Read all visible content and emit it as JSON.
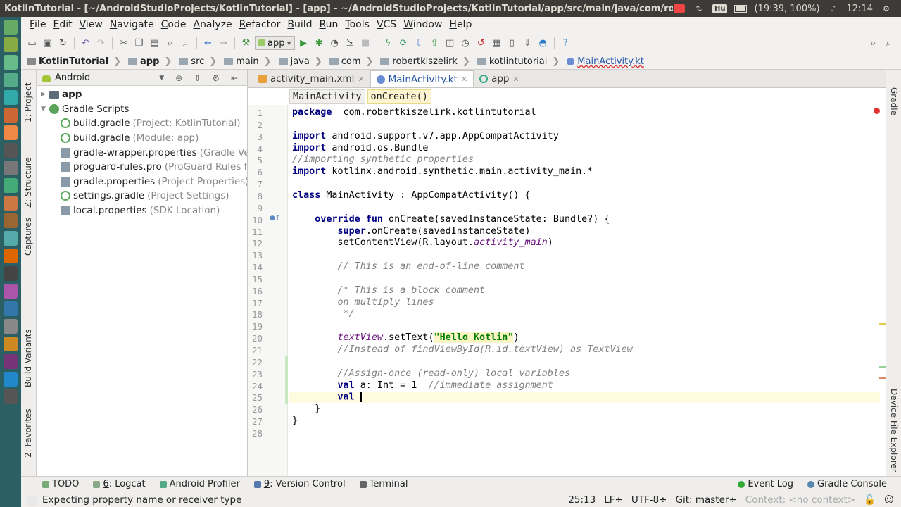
{
  "os": {
    "window_title": "KotlinTutorial - [~/AndroidStudioProjects/KotlinTutorial] - [app] - ~/AndroidStudioProjects/KotlinTutorial/app/src/main/java/com/robertkisze",
    "keyboard_layout": "Hu",
    "battery": "(19:39, 100%)",
    "clock": "12:14"
  },
  "menu": {
    "items": [
      "File",
      "Edit",
      "View",
      "Navigate",
      "Code",
      "Analyze",
      "Refactor",
      "Build",
      "Run",
      "Tools",
      "VCS",
      "Window",
      "Help"
    ]
  },
  "toolbar": {
    "run_config": "app"
  },
  "breadcrumb": {
    "items": [
      "KotlinTutorial",
      "app",
      "src",
      "main",
      "java",
      "com",
      "robertkiszelirk",
      "kotlintutorial",
      "MainActivity.kt"
    ]
  },
  "left_stripe": {
    "project": "1: Project",
    "structure": "Z: Structure",
    "captures": "Captures",
    "build_variants": "Build Variants",
    "favorites": "2: Favorites"
  },
  "project_panel": {
    "view_mode": "Android",
    "tree": [
      {
        "label": "app",
        "hint": "",
        "indent": 0,
        "icon": "folder-icon",
        "expanded": false
      },
      {
        "label": "Gradle Scripts",
        "hint": "",
        "indent": 0,
        "icon": "gradle-scripts-icon",
        "expanded": true
      },
      {
        "label": "build.gradle",
        "hint": "(Project: KotlinTutorial)",
        "indent": 1,
        "icon": "gradle-file-icon"
      },
      {
        "label": "build.gradle",
        "hint": "(Module: app)",
        "indent": 1,
        "icon": "gradle-file-icon"
      },
      {
        "label": "gradle-wrapper.properties",
        "hint": "(Gradle Vers",
        "indent": 1,
        "icon": "properties-file-icon"
      },
      {
        "label": "proguard-rules.pro",
        "hint": "(ProGuard Rules fo",
        "indent": 1,
        "icon": "properties-file-icon"
      },
      {
        "label": "gradle.properties",
        "hint": "(Project Properties)",
        "indent": 1,
        "icon": "properties-file-icon"
      },
      {
        "label": "settings.gradle",
        "hint": "(Project Settings)",
        "indent": 1,
        "icon": "gradle-file-icon"
      },
      {
        "label": "local.properties",
        "hint": "(SDK Location)",
        "indent": 1,
        "icon": "properties-file-icon"
      }
    ]
  },
  "editor": {
    "tabs": [
      {
        "label": "activity_main.xml",
        "active": false
      },
      {
        "label": "MainActivity.kt",
        "active": true
      },
      {
        "label": "app",
        "active": false
      }
    ],
    "crumb_class": "MainActivity",
    "crumb_method": "onCreate()",
    "current_line": 25,
    "lines": [
      {
        "n": "1",
        "parts": [
          [
            "kw",
            "package"
          ],
          [
            "",
            "  com.robertkiszelirk.kotlintutorial"
          ]
        ]
      },
      {
        "n": "2",
        "parts": []
      },
      {
        "n": "3",
        "parts": [
          [
            "kw",
            "import"
          ],
          [
            "",
            " android.support.v7.app.AppCompatActivity"
          ]
        ]
      },
      {
        "n": "4",
        "parts": [
          [
            "kw",
            "import"
          ],
          [
            "",
            " android.os.Bundle"
          ]
        ]
      },
      {
        "n": "5",
        "parts": [
          [
            "cm",
            "//importing synthetic properties"
          ]
        ]
      },
      {
        "n": "6",
        "parts": [
          [
            "kw",
            "import"
          ],
          [
            "",
            " kotlinx.android.synthetic.main.activity_main.*"
          ]
        ]
      },
      {
        "n": "7",
        "parts": []
      },
      {
        "n": "8",
        "parts": [
          [
            "kw",
            "class"
          ],
          [
            "",
            " MainActivity : AppCompatActivity() {"
          ]
        ]
      },
      {
        "n": "9",
        "parts": []
      },
      {
        "n": "10",
        "parts": [
          [
            "",
            "    "
          ],
          [
            "kw",
            "override fun"
          ],
          [
            "",
            " onCreate(savedInstanceState: Bundle?) {"
          ]
        ]
      },
      {
        "n": "11",
        "parts": [
          [
            "",
            "        "
          ],
          [
            "kw",
            "super"
          ],
          [
            "",
            ".onCreate(savedInstanceState)"
          ]
        ]
      },
      {
        "n": "12",
        "parts": [
          [
            "",
            "        setContentView(R.layout."
          ],
          [
            "prop",
            "activity_main"
          ],
          [
            "",
            ")"
          ]
        ]
      },
      {
        "n": "13",
        "parts": []
      },
      {
        "n": "14",
        "parts": [
          [
            "",
            "        "
          ],
          [
            "cm",
            "// This is an end-of-line comment"
          ]
        ]
      },
      {
        "n": "15",
        "parts": []
      },
      {
        "n": "16",
        "parts": [
          [
            "",
            "        "
          ],
          [
            "cm",
            "/* This is a block comment"
          ]
        ]
      },
      {
        "n": "17",
        "parts": [
          [
            "",
            "        "
          ],
          [
            "cm",
            "on multiply lines"
          ]
        ]
      },
      {
        "n": "18",
        "parts": [
          [
            "",
            "         "
          ],
          [
            "cm",
            "*/"
          ]
        ]
      },
      {
        "n": "19",
        "parts": []
      },
      {
        "n": "20",
        "parts": [
          [
            "",
            "        "
          ],
          [
            "prop",
            "textView"
          ],
          [
            "",
            ".setText("
          ],
          [
            "str",
            "\"Hello Kotlin\""
          ],
          [
            "",
            ")"
          ]
        ]
      },
      {
        "n": "21",
        "parts": [
          [
            "",
            "        "
          ],
          [
            "cm",
            "//Instead of findViewById(R.id.textView) as TextView"
          ]
        ]
      },
      {
        "n": "22",
        "parts": []
      },
      {
        "n": "23",
        "parts": [
          [
            "",
            "        "
          ],
          [
            "cm",
            "//Assign-once (read-only) local variables"
          ]
        ]
      },
      {
        "n": "24",
        "parts": [
          [
            "",
            "        "
          ],
          [
            "kw",
            "val"
          ],
          [
            "",
            " a: Int = 1  "
          ],
          [
            "cm",
            "//immediate assignment"
          ]
        ]
      },
      {
        "n": "25",
        "parts": [
          [
            "",
            "        "
          ],
          [
            "kw",
            "val"
          ],
          [
            "",
            " "
          ]
        ]
      },
      {
        "n": "26",
        "parts": [
          [
            "",
            "    }"
          ]
        ]
      },
      {
        "n": "27",
        "parts": [
          [
            "",
            "}"
          ]
        ]
      },
      {
        "n": "28",
        "parts": []
      }
    ]
  },
  "right_stripe": {
    "gradle": "Gradle",
    "device_explorer": "Device File Explorer"
  },
  "bottom_tabs": {
    "left": [
      "TODO",
      "6: Logcat",
      "Android Profiler",
      "9: Version Control",
      "Terminal"
    ],
    "right": [
      "Event Log",
      "Gradle Console"
    ]
  },
  "status": {
    "message": "Expecting property name or receiver type",
    "position": "25:13",
    "line_sep": "LF÷",
    "encoding": "UTF-8÷",
    "git": "Git: master÷",
    "context": "Context: <no context>"
  },
  "colors": {
    "keyword": "#000080",
    "comment": "#808080",
    "string": "#008000",
    "property": "#660e7a",
    "launcher": "#2c5f63"
  }
}
